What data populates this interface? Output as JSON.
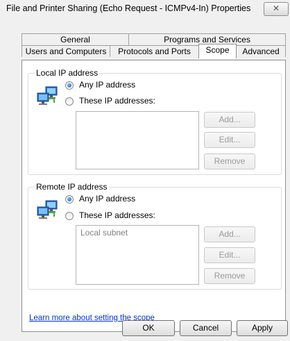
{
  "window": {
    "title": "File and Printer Sharing (Echo Request - ICMPv4-In) Properties",
    "close_glyph": "✕"
  },
  "tabs": {
    "row1": [
      "General",
      "Programs and Services"
    ],
    "row2": [
      "Users and Computers",
      "Protocols and Ports",
      "Scope",
      "Advanced"
    ],
    "active": "Scope"
  },
  "local": {
    "title": "Local IP address",
    "option_any": "Any IP address",
    "option_these": "These IP addresses:",
    "selected": "any",
    "list_items": [],
    "buttons": {
      "add": "Add...",
      "edit": "Edit...",
      "remove": "Remove"
    }
  },
  "remote": {
    "title": "Remote IP address",
    "option_any": "Any IP address",
    "option_these": "These IP addresses:",
    "selected": "any",
    "list_items": [
      "Local subnet"
    ],
    "buttons": {
      "add": "Add...",
      "edit": "Edit...",
      "remove": "Remove"
    }
  },
  "link": {
    "text": "Learn more about setting the scope"
  },
  "footer": {
    "ok": "OK",
    "cancel": "Cancel",
    "apply": "Apply"
  },
  "icons": {
    "network": "network-computers-icon",
    "close": "close-icon"
  },
  "colors": {
    "link": "#0033cc",
    "selection_dot": "#1b5fbf",
    "disabled_text": "#9a9a9a"
  }
}
